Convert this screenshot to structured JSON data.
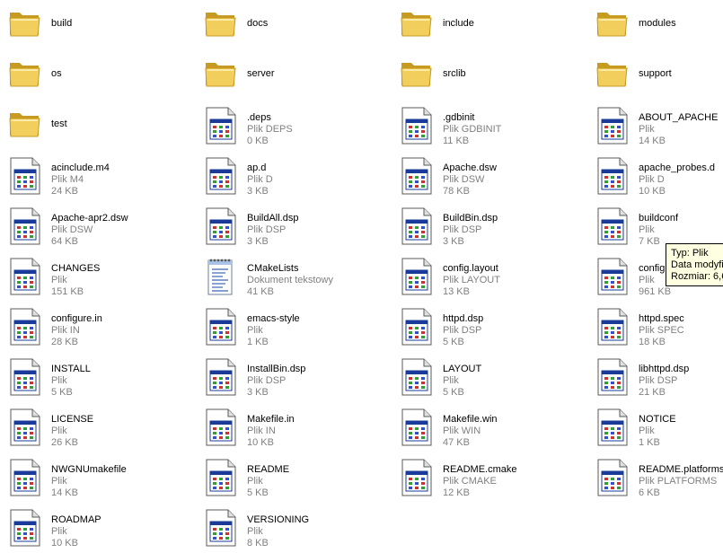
{
  "colors": {
    "folder_fill": "#f2cf5c",
    "folder_dark": "#c79a22",
    "window_bar": "#1a3a9a",
    "tooltip_bg": "#ffffe1",
    "secondary_text": "#808080"
  },
  "items": [
    {
      "name": "build",
      "kind": "folder"
    },
    {
      "name": "docs",
      "kind": "folder"
    },
    {
      "name": "include",
      "kind": "folder"
    },
    {
      "name": "modules",
      "kind": "folder"
    },
    {
      "name": "os",
      "kind": "folder"
    },
    {
      "name": "server",
      "kind": "folder"
    },
    {
      "name": "srclib",
      "kind": "folder"
    },
    {
      "name": "support",
      "kind": "folder"
    },
    {
      "name": "test",
      "kind": "folder"
    },
    {
      "name": ".deps",
      "kind": "file",
      "type": "Plik DEPS",
      "size": "0 KB"
    },
    {
      "name": ".gdbinit",
      "kind": "file",
      "type": "Plik GDBINIT",
      "size": "11 KB"
    },
    {
      "name": "ABOUT_APACHE",
      "kind": "file",
      "type": "Plik",
      "size": "14 KB"
    },
    {
      "name": "acinclude.m4",
      "kind": "file",
      "type": "Plik M4",
      "size": "24 KB"
    },
    {
      "name": "ap.d",
      "kind": "file",
      "type": "Plik D",
      "size": "3 KB"
    },
    {
      "name": "Apache.dsw",
      "kind": "file",
      "type": "Plik DSW",
      "size": "78 KB"
    },
    {
      "name": "apache_probes.d",
      "kind": "file",
      "type": "Plik D",
      "size": "10 KB"
    },
    {
      "name": "Apache-apr2.dsw",
      "kind": "file",
      "type": "Plik DSW",
      "size": "64 KB"
    },
    {
      "name": "BuildAll.dsp",
      "kind": "file",
      "type": "Plik DSP",
      "size": "3 KB"
    },
    {
      "name": "BuildBin.dsp",
      "kind": "file",
      "type": "Plik DSP",
      "size": "3 KB"
    },
    {
      "name": "buildconf",
      "kind": "file",
      "type": "Plik",
      "size": "7 KB"
    },
    {
      "name": "CHANGES",
      "kind": "file",
      "type": "Plik",
      "size": "151 KB"
    },
    {
      "name": "CMakeLists",
      "kind": "text",
      "type": "Dokument tekstowy",
      "size": "41 KB"
    },
    {
      "name": "config.layout",
      "kind": "file",
      "type": "Plik LAYOUT",
      "size": "13 KB"
    },
    {
      "name": "configure",
      "kind": "file",
      "type": "Plik",
      "size": "961 KB",
      "clip": true
    },
    {
      "name": "configure.in",
      "kind": "file",
      "type": "Plik IN",
      "size": "28 KB"
    },
    {
      "name": "emacs-style",
      "kind": "file",
      "type": "Plik",
      "size": "1 KB"
    },
    {
      "name": "httpd.dsp",
      "kind": "file",
      "type": "Plik DSP",
      "size": "5 KB"
    },
    {
      "name": "httpd.spec",
      "kind": "file",
      "type": "Plik SPEC",
      "size": "18 KB"
    },
    {
      "name": "INSTALL",
      "kind": "file",
      "type": "Plik",
      "size": "5 KB"
    },
    {
      "name": "InstallBin.dsp",
      "kind": "file",
      "type": "Plik DSP",
      "size": "3 KB"
    },
    {
      "name": "LAYOUT",
      "kind": "file",
      "type": "Plik",
      "size": "5 KB"
    },
    {
      "name": "libhttpd.dsp",
      "kind": "file",
      "type": "Plik DSP",
      "size": "21 KB"
    },
    {
      "name": "LICENSE",
      "kind": "file",
      "type": "Plik",
      "size": "26 KB"
    },
    {
      "name": "Makefile.in",
      "kind": "file",
      "type": "Plik IN",
      "size": "10 KB"
    },
    {
      "name": "Makefile.win",
      "kind": "file",
      "type": "Plik WIN",
      "size": "47 KB"
    },
    {
      "name": "NOTICE",
      "kind": "file",
      "type": "Plik",
      "size": "1 KB"
    },
    {
      "name": "NWGNUmakefile",
      "kind": "file",
      "type": "Plik",
      "size": "14 KB"
    },
    {
      "name": "README",
      "kind": "file",
      "type": "Plik",
      "size": "5 KB"
    },
    {
      "name": "README.cmake",
      "kind": "file",
      "type": "Plik CMAKE",
      "size": "12 KB"
    },
    {
      "name": "README.platforms",
      "kind": "file",
      "type": "Plik PLATFORMS",
      "size": "6 KB"
    },
    {
      "name": "ROADMAP",
      "kind": "file",
      "type": "Plik",
      "size": "10 KB"
    },
    {
      "name": "VERSIONING",
      "kind": "file",
      "type": "Plik",
      "size": "8 KB"
    }
  ],
  "tooltip": {
    "line1": "Typ: Plik",
    "line2": "Data modyfi",
    "line3": "Rozmiar: 6,6"
  }
}
